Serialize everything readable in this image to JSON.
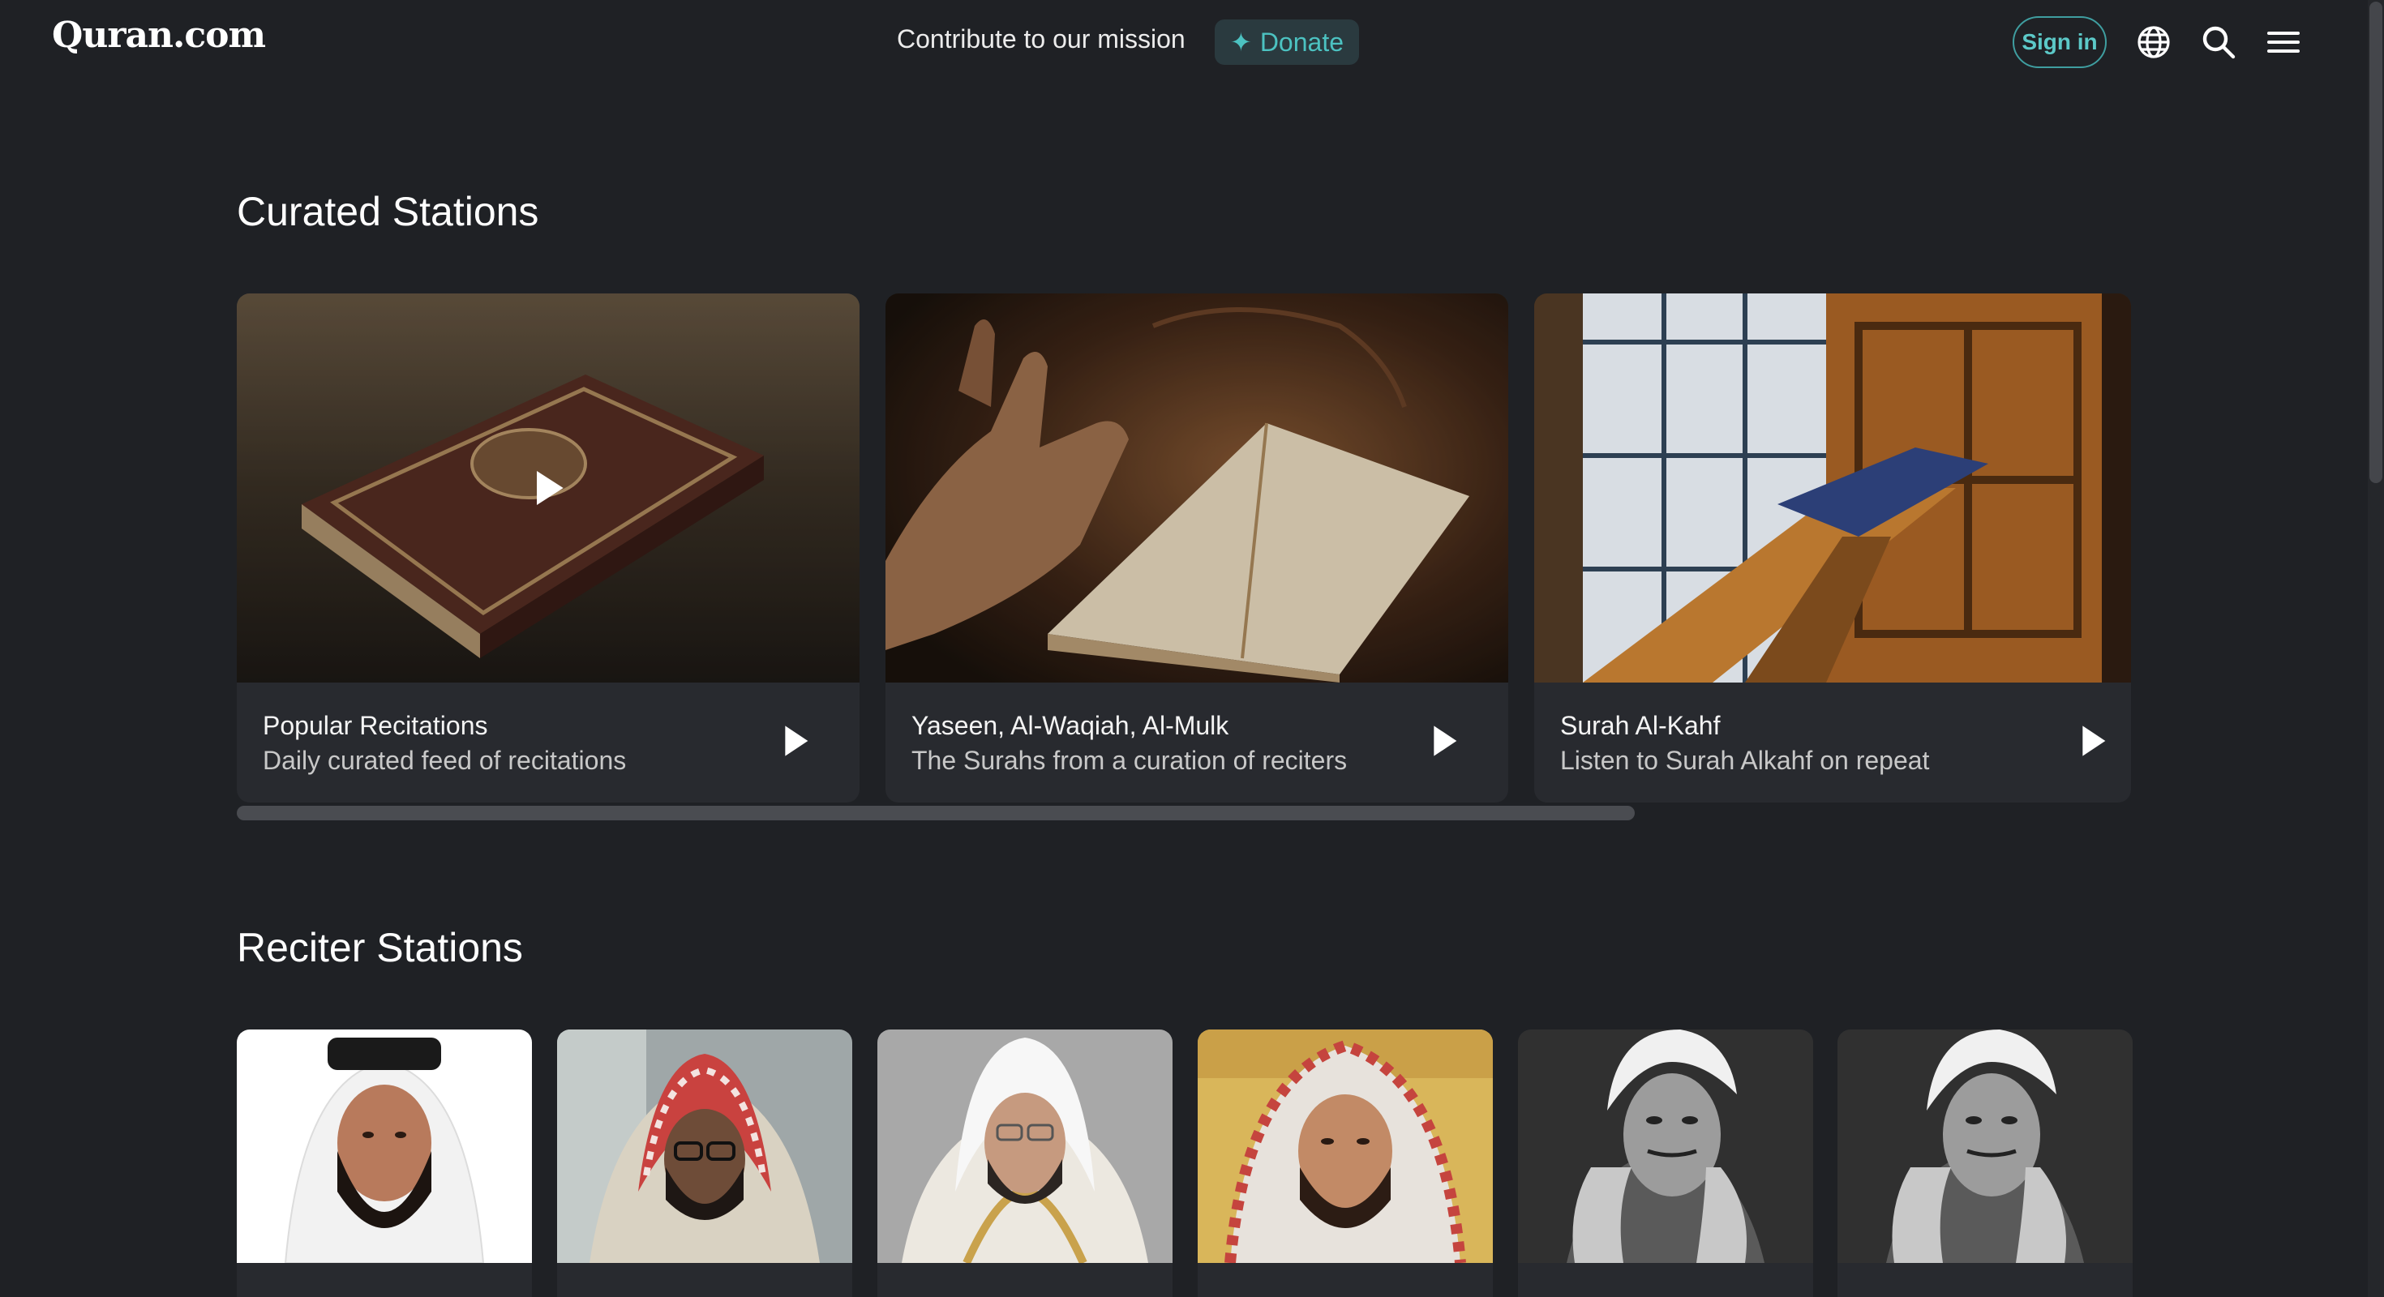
{
  "header": {
    "logo": "Quran.com",
    "mission_text": "Contribute to our mission",
    "donate_label": "Donate",
    "signin_label": "Sign in"
  },
  "icons": {
    "donate": "sparkle-icon",
    "language": "globe-icon",
    "search": "search-icon",
    "menu": "hamburger-menu-icon",
    "play": "play-icon"
  },
  "curated": {
    "title": "Curated Stations",
    "cards": [
      {
        "title": "Popular Recitations",
        "subtitle": "Daily curated feed of recitations"
      },
      {
        "title": "Yaseen, Al-Waqiah, Al-Mulk",
        "subtitle": "The Surahs from a curation of reciters"
      },
      {
        "title": "Surah Al-Kahf",
        "subtitle": "Listen to Surah Alkahf on repeat"
      }
    ]
  },
  "reciters": {
    "title": "Reciter Stations",
    "count_visible": 6
  },
  "colors": {
    "background": "#1f2125",
    "card": "#282a2f",
    "accent": "#4cc2c1"
  }
}
